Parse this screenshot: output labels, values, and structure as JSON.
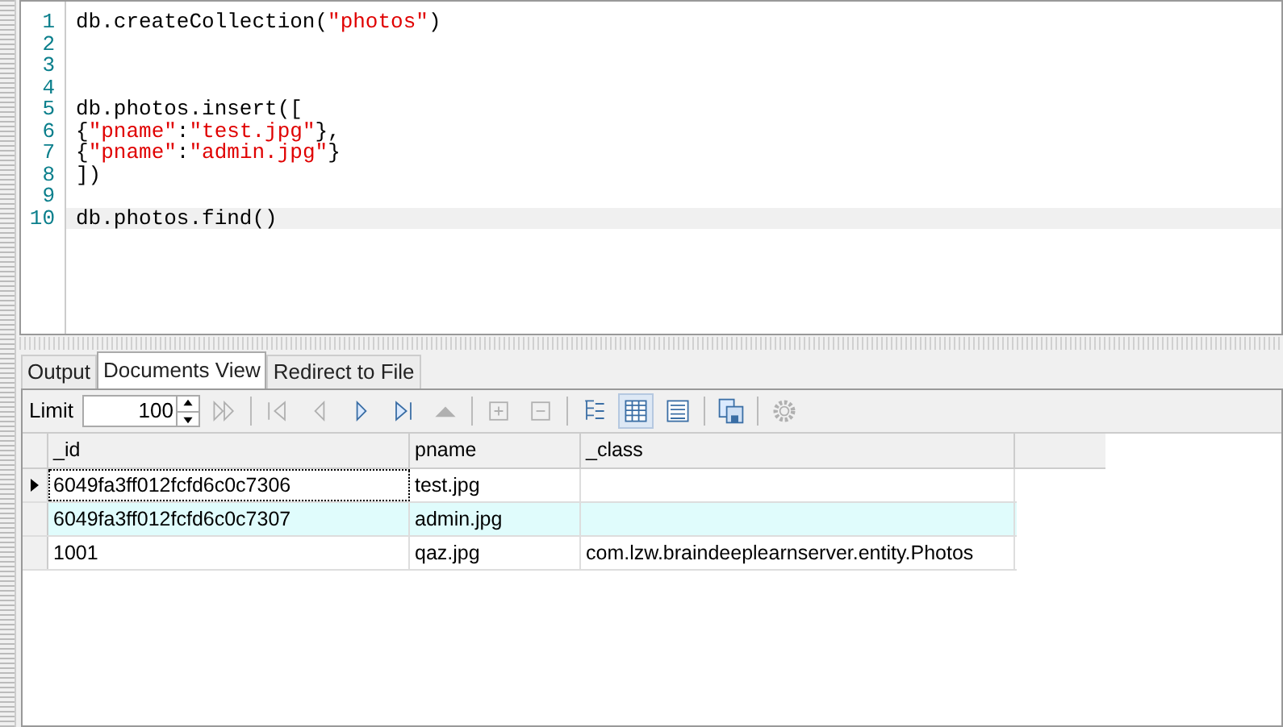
{
  "editor": {
    "lines": [
      {
        "number": "1",
        "current": false,
        "segments": [
          {
            "kind": "plain",
            "text": "db.createCollection("
          },
          {
            "kind": "string",
            "text": "\"photos\""
          },
          {
            "kind": "plain",
            "text": ")"
          }
        ]
      },
      {
        "number": "2",
        "current": false
      },
      {
        "number": "3",
        "current": false
      },
      {
        "number": "4",
        "current": false
      },
      {
        "number": "5",
        "current": false,
        "segments": [
          {
            "kind": "plain",
            "text": "db.photos.insert(["
          }
        ]
      },
      {
        "number": "6",
        "current": false,
        "segments": [
          {
            "kind": "plain",
            "text": "{"
          },
          {
            "kind": "string",
            "text": "\"pname\""
          },
          {
            "kind": "plain",
            "text": ":"
          },
          {
            "kind": "string",
            "text": "\"test.jpg\""
          },
          {
            "kind": "plain",
            "text": "},"
          }
        ]
      },
      {
        "number": "7",
        "current": false,
        "segments": [
          {
            "kind": "plain",
            "text": "{"
          },
          {
            "kind": "string",
            "text": "\"pname\""
          },
          {
            "kind": "plain",
            "text": ":"
          },
          {
            "kind": "string",
            "text": "\"admin.jpg\""
          },
          {
            "kind": "plain",
            "text": "}"
          }
        ]
      },
      {
        "number": "8",
        "current": false,
        "segments": [
          {
            "kind": "plain",
            "text": "])"
          }
        ]
      },
      {
        "number": "9",
        "current": false
      },
      {
        "number": "10",
        "current": true,
        "segments": [
          {
            "kind": "plain",
            "text": "db.photos.find()"
          }
        ]
      }
    ]
  },
  "tabs": [
    {
      "label": "Output",
      "selected": false
    },
    {
      "label": "Documents View",
      "selected": true
    },
    {
      "label": "Redirect to File",
      "selected": false
    }
  ],
  "toolbar": {
    "limit_label": "Limit",
    "limit_value": "100",
    "tools": [
      {
        "kind": "fast-forward",
        "disabled": true
      },
      {
        "kind": "sep"
      },
      {
        "kind": "first",
        "disabled": true
      },
      {
        "kind": "prev",
        "disabled": true
      },
      {
        "kind": "next",
        "disabled": false
      },
      {
        "kind": "last",
        "disabled": false
      },
      {
        "kind": "up",
        "disabled": true
      },
      {
        "kind": "sep"
      },
      {
        "kind": "plus",
        "disabled": true
      },
      {
        "kind": "minus",
        "disabled": true
      },
      {
        "kind": "sep"
      },
      {
        "kind": "tree",
        "disabled": false,
        "selected": false
      },
      {
        "kind": "table",
        "disabled": false,
        "selected": true
      },
      {
        "kind": "text",
        "disabled": false,
        "selected": false
      },
      {
        "kind": "sep"
      },
      {
        "kind": "save",
        "disabled": false
      },
      {
        "kind": "sep"
      },
      {
        "kind": "gear",
        "disabled": true
      }
    ]
  },
  "table": {
    "columns": [
      "_id",
      "pname",
      "_class"
    ],
    "rows": [
      {
        "current": true,
        "selected": false,
        "cells": [
          "6049fa3ff012fcfd6c0c7306",
          "test.jpg",
          ""
        ]
      },
      {
        "current": false,
        "selected": true,
        "cells": [
          "6049fa3ff012fcfd6c0c7307",
          "admin.jpg",
          ""
        ]
      },
      {
        "current": false,
        "selected": false,
        "cells": [
          "1001",
          "qaz.jpg",
          "com.lzw.braindeeplearnserver.entity.Photos"
        ]
      }
    ]
  }
}
